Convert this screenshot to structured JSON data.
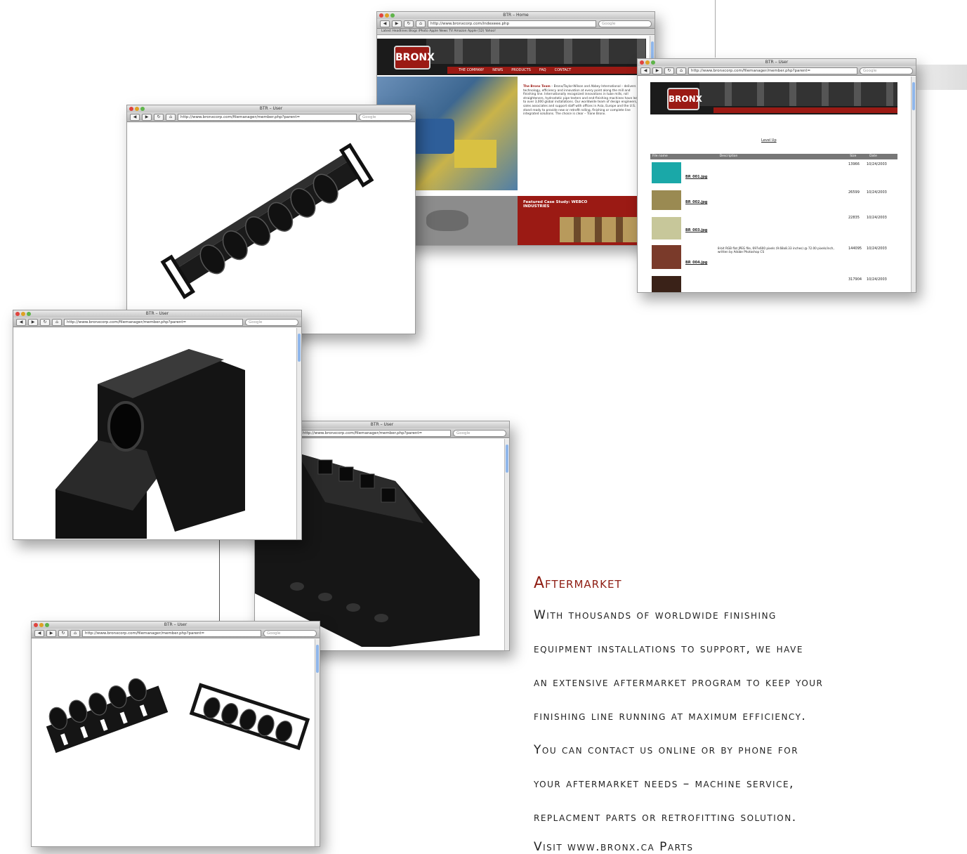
{
  "windows": {
    "home": {
      "title": "BTR – Home",
      "url": "http://www.bronxcorp.com/indexeee.php",
      "search_placeholder": "Google",
      "bookmarks": "Latest Headlines  Blogs  iPhoto  Apple  News  TV  Amazon  Apple (12)  Yahoo!",
      "logo": "BRONX",
      "nav": [
        "THE COMPANY",
        "NEWS",
        "PRODUCTS",
        "FAQ",
        "CONTACT"
      ],
      "intro_title": "The Bronx Team",
      "intro_text": "– Bronx/Taylor-Wilson and Abbey International – delivers technology, efficiency and innovation at every point along the mill and finishing line. Internationally recognized innovations in tube mills, roll straighteners, hydrostatic pipe testers and end-finishing machines have lead to over 3,000 global installations. Our worldwide team of design engineers, sales associates and support staff with offices in Asia, Europe and the U.S. stand ready to provide new or retrofit rolling, finishing or complete line integrated solutions. The choice is clear – Trane Bronx.",
      "case_study": "Featured Case Study: WEBCO INDUSTRIES"
    },
    "filemanager_list": {
      "title": "BTR – User",
      "url": "http://www.bronxcorp.com/filemanager/member.php?parent=",
      "search_placeholder": "Google",
      "logo": "BRONX",
      "level_up": "Level Up",
      "columns": [
        "File name",
        "Description",
        "Size",
        "Date"
      ],
      "rows": [
        {
          "name": "BR_001.jpg",
          "description": "",
          "size": "13966",
          "date": "10/24/2003"
        },
        {
          "name": "BR_002.jpg",
          "description": "",
          "size": "26599",
          "date": "10/24/2003"
        },
        {
          "name": "BR_003.jpg",
          "description": "",
          "size": "22835",
          "date": "10/24/2003"
        },
        {
          "name": "BR_004.jpg",
          "description": "8-bit RGB flat JPEG file, 697x600 pixels (9.68x8.33 inches) @ 72.00 pixels/inch, written by Adobe Photoshop CS",
          "size": "144095",
          "date": "10/24/2003"
        },
        {
          "name": "",
          "description": "",
          "size": "317904",
          "date": "10/24/2003"
        }
      ],
      "tab_title": "BTR – User"
    },
    "viewer1": {
      "title": "BTR – User",
      "url": "http://www.bronxcorp.com/filemanager/member.php?parent=",
      "search_placeholder": "Google"
    },
    "viewer2": {
      "title": "BTR – User",
      "url": "http://www.bronxcorp.com/filemanager/member.php?parent=",
      "search_placeholder": "Google"
    },
    "viewer3": {
      "title": "BTR – User",
      "url": "http://www.bronxcorp.com/filemanager/member.php?parent=",
      "search_placeholder": "Google"
    },
    "viewer4": {
      "title": "BTR – User",
      "url": "http://www.bronxcorp.com/filemanager/member.php?parent=",
      "search_placeholder": "Google"
    }
  },
  "aftermarket": {
    "heading": "Aftermarket",
    "lines": [
      "With thousands of worldwide finishing",
      "equipment installations to support, we have",
      "an extensive aftermarket program to keep your",
      "finishing line running at maximum efficiency.",
      "You can contact us online or by phone for",
      "your aftermarket needs – machine service,",
      "replacment parts or retrofitting solution.",
      "Visit www.bronx.ca Parts"
    ]
  },
  "colors": {
    "brand_red": "#9b1a14",
    "heading_red": "#8e1d13"
  }
}
